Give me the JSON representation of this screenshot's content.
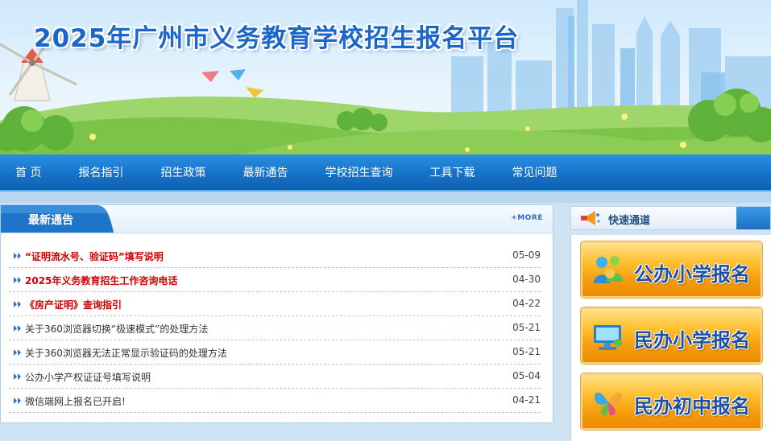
{
  "banner": {
    "title": "2025年广州市义务教育学校招生报名平台"
  },
  "nav": {
    "items": [
      {
        "label": "首  页"
      },
      {
        "label": "报名指引"
      },
      {
        "label": "招生政策"
      },
      {
        "label": "最新通告"
      },
      {
        "label": "学校招生查询"
      },
      {
        "label": "工具下载"
      },
      {
        "label": "常见问题"
      }
    ]
  },
  "notices": {
    "title": "最新通告",
    "more_label": "+MORE",
    "items": [
      {
        "text": "“证明流水号、验证码”填写说明",
        "date": "05-09",
        "highlight": true
      },
      {
        "text": "2025年义务教育招生工作咨询电话",
        "date": "04-30",
        "highlight": true
      },
      {
        "text": "《房产证明》查询指引",
        "date": "04-22",
        "highlight": true
      },
      {
        "text": "关于360浏览器切换“极速模式”的处理方法",
        "date": "05-21",
        "highlight": false
      },
      {
        "text": "关于360浏览器无法正常显示验证码的处理方法",
        "date": "05-21",
        "highlight": false
      },
      {
        "text": "公办小学产权证证号填写说明",
        "date": "05-04",
        "highlight": false
      },
      {
        "text": "微信端网上报名已开启!",
        "date": "04-21",
        "highlight": false
      }
    ]
  },
  "quick": {
    "title": "快速通道",
    "buttons": [
      {
        "label": "公办小学报名",
        "icon": "people-icon"
      },
      {
        "label": "民办小学报名",
        "icon": "computer-icon"
      },
      {
        "label": "民办初中报名",
        "icon": "butterfly-icon"
      }
    ]
  },
  "colors": {
    "nav": "#1672c9",
    "accent_red": "#d40000",
    "title_blue": "#1a66c9",
    "button_orange": "#f59d0c"
  }
}
